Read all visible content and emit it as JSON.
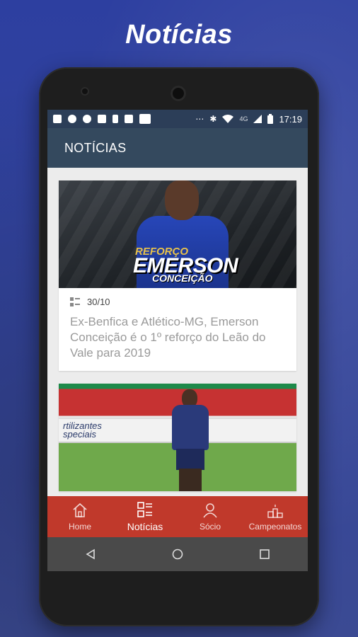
{
  "promo": {
    "title": "Notícias"
  },
  "statusbar": {
    "network": "4G",
    "time": "17:19",
    "icons": [
      "notification-icon",
      "soccer-ball-icon",
      "hand-icon",
      "gif-icon",
      "person-icon",
      "image-icon",
      "square-icon",
      "more-icon",
      "bluetooth-icon",
      "wifi-icon",
      "signal-icon",
      "battery-icon"
    ]
  },
  "appbar": {
    "title": "NOTÍCIAS"
  },
  "news": [
    {
      "date": "30/10",
      "title": "Ex-Benfica e Atlético-MG, Emerson Conceição é o 1º reforço do Leão do Vale para 2019",
      "image": {
        "label_top": "REFORÇO",
        "name": "EMERSON",
        "surname": "CONCEIÇÃO"
      }
    },
    {
      "image": {
        "ad_text": "rtilizantes\nspeciais"
      }
    }
  ],
  "bottomnav": {
    "items": [
      {
        "label": "Home",
        "icon": "home-icon",
        "active": false
      },
      {
        "label": "Notícias",
        "icon": "news-icon",
        "active": true
      },
      {
        "label": "Sócio",
        "icon": "user-icon",
        "active": false
      },
      {
        "label": "Campeonatos",
        "icon": "podium-icon",
        "active": false
      }
    ]
  },
  "colors": {
    "statusbar": "#2c3e58",
    "appbar": "#34495e",
    "bottomnav": "#c0392b",
    "background": "#2d3fa0"
  }
}
